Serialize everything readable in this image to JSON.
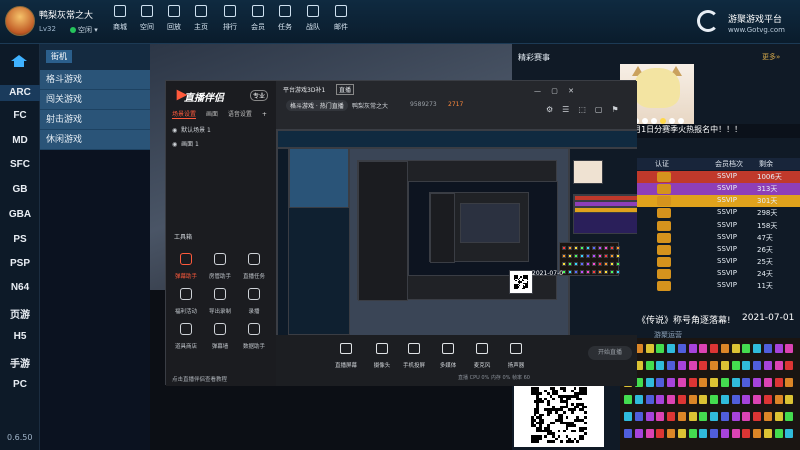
{
  "user": {
    "name": "鸭梨灰常之大",
    "level": "Lv32",
    "status": "空闲"
  },
  "nav": [
    {
      "label": "商城",
      "icon": "shop-icon"
    },
    {
      "label": "空间",
      "icon": "space-icon"
    },
    {
      "label": "回放",
      "icon": "replay-icon"
    },
    {
      "label": "主页",
      "icon": "home-icon"
    },
    {
      "label": "排行",
      "icon": "rank-icon"
    },
    {
      "label": "会员",
      "icon": "vip-icon"
    },
    {
      "label": "任务",
      "icon": "task-icon"
    },
    {
      "label": "战队",
      "icon": "team-icon"
    },
    {
      "label": "邮件",
      "icon": "mail-icon"
    }
  ],
  "brand": {
    "name": "游聚游戏平台",
    "url": "www.Gotvg.com"
  },
  "platforms": [
    "ARC",
    "FC",
    "MD",
    "SFC",
    "GB",
    "GBA",
    "PS",
    "PSP",
    "N64",
    "页游",
    "H5",
    "手游",
    "PC"
  ],
  "version": "0.6.50",
  "submenu": {
    "header": "街机",
    "items": [
      "格斗游戏",
      "闯关游戏",
      "射击游戏",
      "休闲游戏"
    ]
  },
  "right_panel": {
    "title": "精彩赛事",
    "more": "更多»",
    "marquee": "年8月1日分赛季火热报名中！！！",
    "rank_header": {
      "col1": "认证",
      "col2": "会员档次",
      "col3": "剩余"
    },
    "rank_rows": [
      {
        "vip": "SSVIP",
        "days": "1006天",
        "color": "#c0392b"
      },
      {
        "vip": "SSVIP",
        "days": "313天",
        "color": "#8e3fb8"
      },
      {
        "vip": "SSVIP",
        "days": "301天",
        "color": "#e0a21c"
      },
      {
        "vip": "SSVIP",
        "days": "298天",
        "color": ""
      },
      {
        "vip": "SSVIP",
        "days": "158天",
        "color": ""
      },
      {
        "vip": "SSVIP",
        "days": "47天",
        "color": ""
      },
      {
        "vip": "SSVIP",
        "days": "26天",
        "color": ""
      },
      {
        "vip": "SSVIP",
        "days": "25天",
        "color": ""
      },
      {
        "vip": "SSVIP",
        "days": "24天",
        "color": ""
      },
      {
        "vip": "SSVIP",
        "days": "11天",
        "color": ""
      }
    ],
    "news": "《传说》称号角逐落幕!",
    "news_date": "2021-07-01",
    "news_sub": "游聚运营"
  },
  "stream_app": {
    "name": "直播伴侣",
    "version_tag": "专业",
    "tabs": [
      "场景设置",
      "画面",
      "语音设置"
    ],
    "scenes": [
      "默认场景 1",
      "画面 1"
    ],
    "tools_title": "工具箱",
    "tools": [
      {
        "label": "弹幕助手",
        "hot": true
      },
      {
        "label": "房管助手",
        "hot": false
      },
      {
        "label": "直播任务",
        "hot": false
      },
      {
        "label": "福利活动",
        "hot": false
      },
      {
        "label": "导出录制",
        "hot": false
      },
      {
        "label": "录播",
        "hot": false
      },
      {
        "label": "道具商店",
        "hot": false
      },
      {
        "label": "弹幕墙",
        "hot": false
      },
      {
        "label": "数据助手",
        "hot": false
      }
    ],
    "hint": "点击直播伴侣查看教程",
    "room_title": "平台游戏3D补1",
    "room_tag": "直播",
    "category": "格斗游戏 · 热门直播",
    "host": "鸭梨灰常之大",
    "fans": "9589273",
    "heat": "2717",
    "window_buttons": "— ▢ ✕",
    "bottom_buttons": [
      "直播屏幕",
      "摄像头",
      "手机投屏",
      "多媒体",
      "麦克风",
      "扬声器"
    ],
    "start_label": "开始直播",
    "stats": "直播 CPU 0%  内存 0%  帧率 60"
  },
  "nested_date": "2021-07-0"
}
